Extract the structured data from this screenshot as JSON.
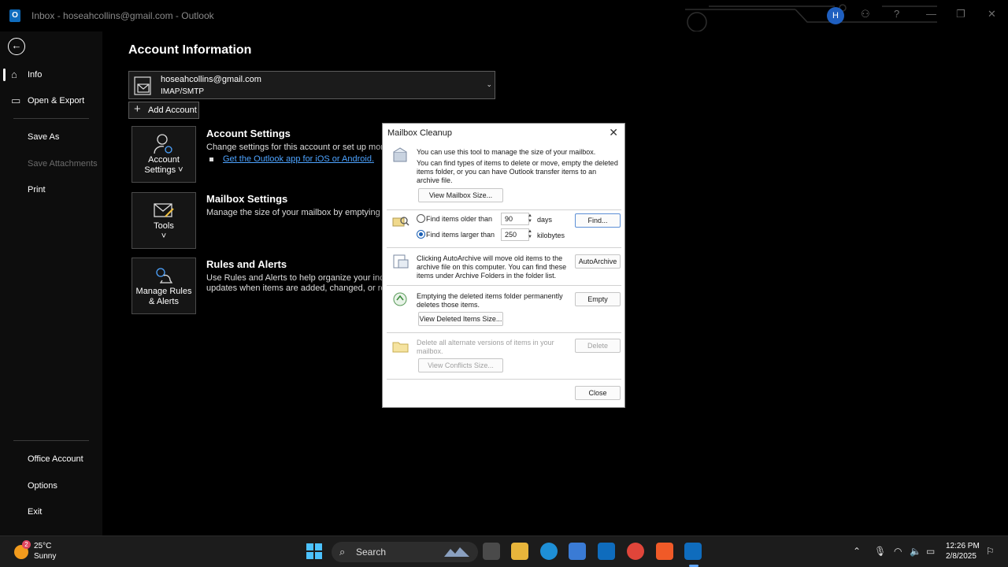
{
  "window": {
    "title": "Inbox - hoseahcollins@gmail.com - Outlook",
    "avatar_initial": "H",
    "help_glyph": "?"
  },
  "nav": {
    "items": [
      {
        "label": "Info"
      },
      {
        "label": "Open & Export"
      },
      {
        "label": "Save As"
      },
      {
        "label": "Save Attachments"
      },
      {
        "label": "Print"
      },
      {
        "label": "Office Account"
      },
      {
        "label": "Options"
      },
      {
        "label": "Exit"
      }
    ]
  },
  "main": {
    "page_title": "Account Information",
    "account": {
      "email": "hoseahcollins@gmail.com",
      "type": "IMAP/SMTP"
    },
    "add_account_label": "Add Account",
    "sections": [
      {
        "tile_label_1": "Account",
        "tile_label_2": "Settings ˅",
        "title": "Account Settings",
        "desc": "Change settings for this account or set up more co",
        "link": "Get the Outlook app for iOS or Android."
      },
      {
        "tile_label_1": "Tools",
        "tile_label_2": "˅",
        "title": "Mailbox Settings",
        "desc": "Manage the size of your mailbox by emptying Dele"
      },
      {
        "tile_label_1": "Manage Rules",
        "tile_label_2": "& Alerts",
        "title": "Rules and Alerts",
        "desc_1": "Use Rules and Alerts to help organize your incomin",
        "desc_2": "updates when items are added, changed, or remov"
      }
    ]
  },
  "dialog": {
    "title": "Mailbox Cleanup",
    "intro_1": "You can use this tool to manage the size of your mailbox.",
    "intro_2": "You can find types of items to delete or move, empty the deleted items folder, or you can have Outlook transfer items to an archive file.",
    "view_mailbox_size": "View Mailbox Size...",
    "find_older_label": "Find items older than",
    "older_value": "90",
    "older_unit": "days",
    "find_larger_label": "Find items larger than",
    "larger_value": "250",
    "larger_unit": "kilobytes",
    "selected_option": "larger",
    "find_button": "Find...",
    "autoarchive_text": "Clicking AutoArchive will move old items to the archive file on this computer. You can find these items under Archive Folders in the folder list.",
    "autoarchive_button": "AutoArchive",
    "empty_text": "Emptying the deleted items folder permanently deletes those items.",
    "empty_button": "Empty",
    "view_deleted_size": "View Deleted Items Size...",
    "conflicts_text": "Delete all alternate versions of items in your mailbox.",
    "delete_button": "Delete",
    "view_conflicts_size": "View Conflicts Size...",
    "close_button": "Close"
  },
  "taskbar": {
    "weather_temp": "25°C",
    "weather_cond": "Sunny",
    "weather_badge": "2",
    "search_label": "Search",
    "time": "12:26 PM",
    "date": "2/8/2025"
  }
}
